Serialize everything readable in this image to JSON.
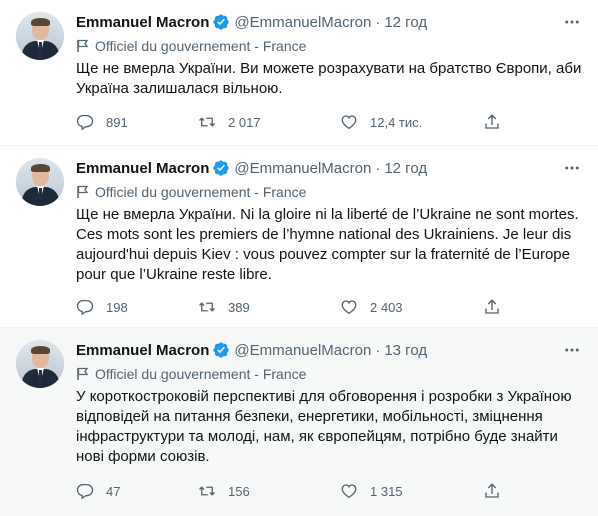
{
  "tweets": [
    {
      "name": "Emmanuel Macron",
      "handle": "@EmmanuelMacron",
      "separator": "·",
      "time": "12 год",
      "label": "Officiel du gouvernement - France",
      "text": "Ще не вмерла України. Ви можете розрахувати на братство Європи, аби Україна залишалася вільною.",
      "replies": "891",
      "retweets": "2 017",
      "likes": "12,4 тис."
    },
    {
      "name": "Emmanuel Macron",
      "handle": "@EmmanuelMacron",
      "separator": "·",
      "time": "12 год",
      "label": "Officiel du gouvernement - France",
      "text": "Ще не вмерла України. Ni la gloire ni la liberté de l’Ukraine ne sont mortes. Ces mots sont les premiers de l’hymne national des Ukrainiens. Je leur dis aujourd'hui depuis Kiev : vous pouvez compter sur la fraternité de l’Europe pour que l’Ukraine reste libre.",
      "replies": "198",
      "retweets": "389",
      "likes": "2 403"
    },
    {
      "name": "Emmanuel Macron",
      "handle": "@EmmanuelMacron",
      "separator": "·",
      "time": "13 год",
      "label": "Officiel du gouvernement - France",
      "text": "У короткостроковій перспективі для обговорення і розробки з Україною відповідей на питання безпеки, енергетики, мобільності, зміцнення інфраструктури та молоді, нам, як європейцям, потрібно буде знайти нові форми союзів.",
      "replies": "47",
      "retweets": "156",
      "likes": "1 315"
    }
  ],
  "colors": {
    "verified": "#1d9bf0",
    "secondary_text": "#536471",
    "primary_text": "#0f1419",
    "divider": "#eff3f4",
    "highlight_bg": "#f7f9f9"
  },
  "icons": {
    "verified": "verified-badge-icon",
    "more": "more-options-icon",
    "label": "flag-icon",
    "reply": "reply-icon",
    "retweet": "retweet-icon",
    "like": "heart-icon",
    "share": "share-icon"
  }
}
